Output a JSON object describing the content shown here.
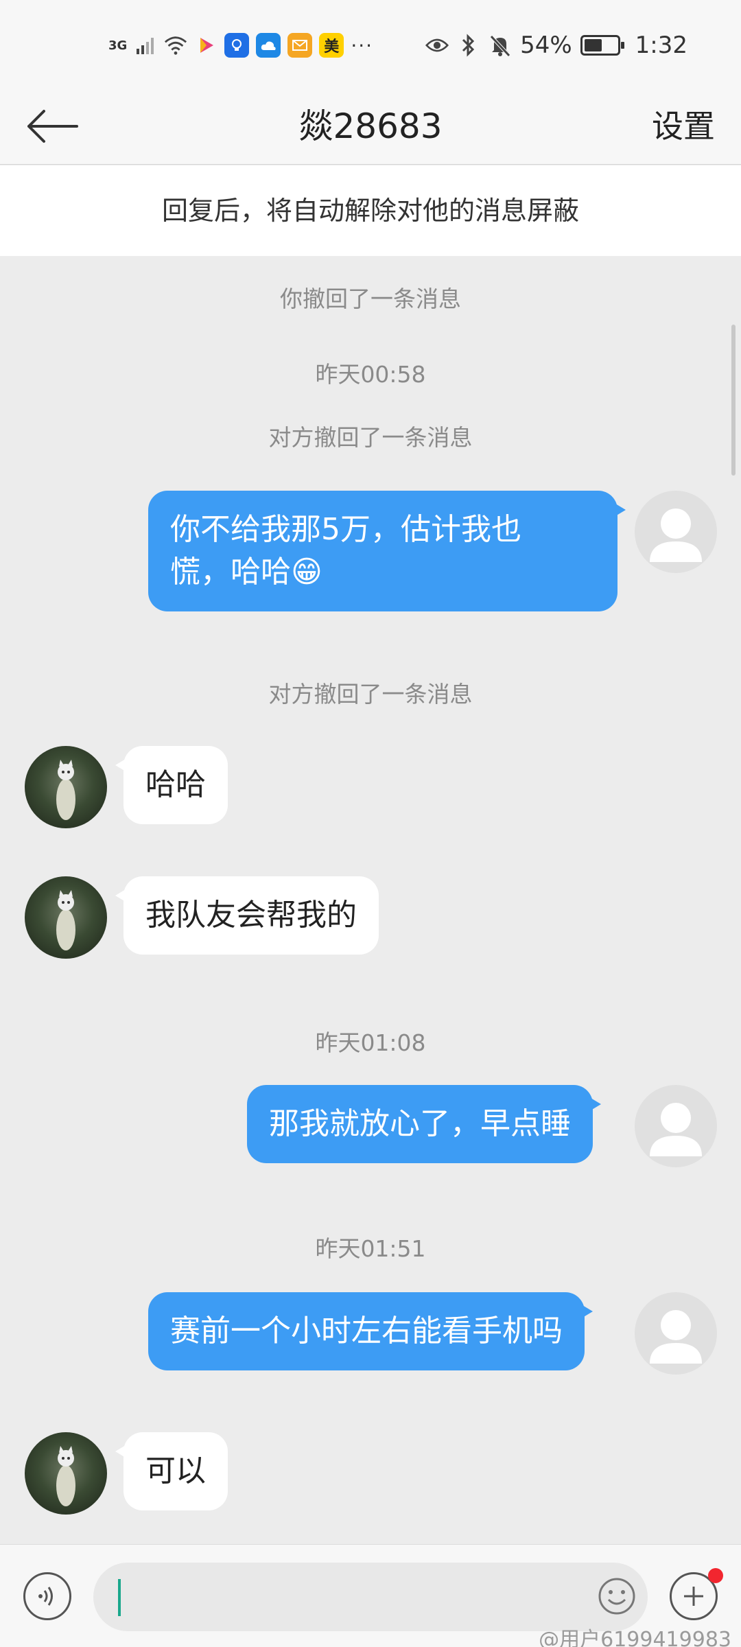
{
  "status_bar": {
    "network": "3G",
    "battery_percent": "54%",
    "battery_level": 0.54,
    "time": "1:32",
    "more": "···",
    "app_badge_mei": "美",
    "icons": [
      "signal-icon",
      "wifi-icon",
      "video-app-icon",
      "bulb-app-icon",
      "cloud-app-icon",
      "mail-app-icon",
      "eye-icon",
      "bluetooth-icon",
      "mute-icon"
    ]
  },
  "header": {
    "title": "燚28683",
    "settings_label": "设置"
  },
  "notice": "回复后，将自动解除对他的消息屏蔽",
  "chat": {
    "sys_recall_you": "你撤回了一条消息",
    "time_1": "昨天00:58",
    "sys_recall_other_1": "对方撤回了一条消息",
    "msg_out_1_line1": "你不给我那5万，估计我也",
    "msg_out_1_line2": "慌，哈哈😁",
    "sys_recall_other_2": "对方撤回了一条消息",
    "msg_in_1": "哈哈",
    "msg_in_2": "我队友会帮我的",
    "time_2": "昨天01:08",
    "msg_out_2": "那我就放心了，早点睡",
    "time_3": "昨天01:51",
    "msg_out_3": "赛前一个小时左右能看手机吗",
    "msg_in_3": "可以"
  },
  "input": {
    "value": "",
    "placeholder": ""
  },
  "watermark": "@用户6199419983",
  "colors": {
    "outgoing_bubble": "#3d9cf4",
    "incoming_bubble": "#ffffff",
    "chat_background": "#ececec",
    "badge_red": "#f2262f"
  }
}
